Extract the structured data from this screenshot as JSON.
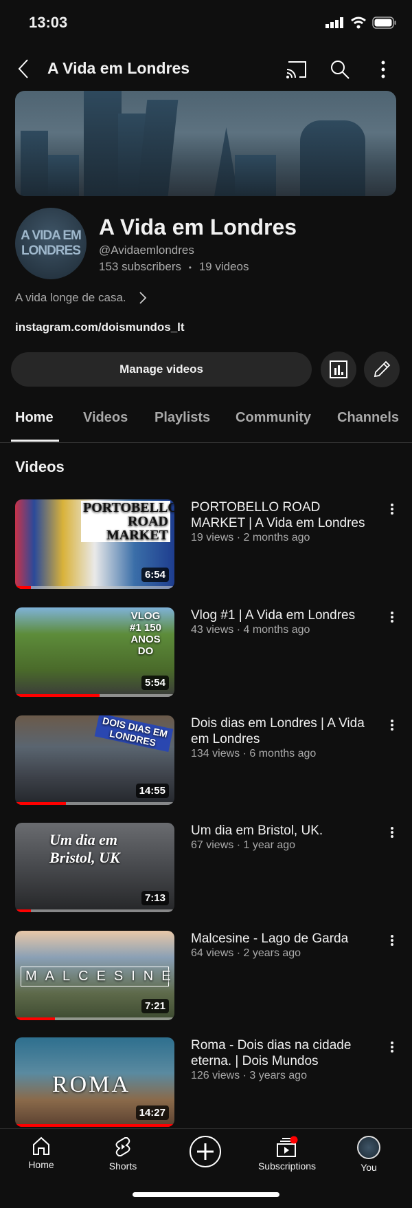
{
  "status_bar": {
    "time": "13:03"
  },
  "top_bar": {
    "title": "A Vida em Londres",
    "icons": [
      "back-icon",
      "cast-icon",
      "search-icon",
      "more-vertical-icon"
    ]
  },
  "channel": {
    "avatar_text": [
      "A VIDA EM",
      "LONDRES"
    ],
    "name": "A Vida em Londres",
    "handle": "@Avidaemlondres",
    "subscribers": "153 subscribers",
    "separator": "•",
    "videos_count": "19 videos",
    "description": "A vida longe de casa.",
    "link": "instagram.com/doismundos_lt"
  },
  "actions": {
    "manage_label": "Manage videos",
    "icons": [
      "analytics-icon",
      "edit-pencil-icon"
    ]
  },
  "tabs": [
    {
      "label": "Home",
      "active": true
    },
    {
      "label": "Videos"
    },
    {
      "label": "Playlists"
    },
    {
      "label": "Community"
    },
    {
      "label": "Channels"
    }
  ],
  "section_title": "Videos",
  "videos": [
    {
      "title": "PORTOBELLO ROAD MARKET | A Vida em Londres",
      "meta": "19 views · 2 months ago",
      "duration": "6:54",
      "progress": 0.1,
      "thumb_caption": "PORTOBELLO ROAD MARKET"
    },
    {
      "title": "Vlog #1 | A Vida em Londres",
      "meta": "43 views · 4 months ago",
      "duration": "5:54",
      "progress": 0.53,
      "thumb_caption": "VLOG #1 150 ANOS DO"
    },
    {
      "title": "Dois dias em Londres | A Vida em Londres",
      "meta": "134 views · 6 months ago",
      "duration": "14:55",
      "progress": 0.32,
      "thumb_caption": "DOIS DIAS EM LONDRES"
    },
    {
      "title": "Um dia em Bristol, UK.",
      "meta": "67 views · 1 year ago",
      "duration": "7:13",
      "progress": 0.1,
      "thumb_caption": "Um dia em Bristol, UK"
    },
    {
      "title": "Malcesine - Lago de Garda",
      "meta": "64 views · 2 years ago",
      "duration": "7:21",
      "progress": 0.25,
      "thumb_caption": "MALCESINE"
    },
    {
      "title": "Roma - Dois dias na cidade eterna. | Dois Mundos",
      "meta": "126 views · 3 years ago",
      "duration": "14:27",
      "progress": 1.0,
      "thumb_caption": "ROMA"
    }
  ],
  "bottom_nav": [
    {
      "label": "Home",
      "icon": "home-icon"
    },
    {
      "label": "Shorts",
      "icon": "shorts-icon"
    },
    {
      "label": "",
      "icon": "create-plus-icon"
    },
    {
      "label": "Subscriptions",
      "icon": "subscriptions-icon",
      "badge": true
    },
    {
      "label": "You",
      "icon": "avatar"
    }
  ],
  "colors": {
    "background": "#0f0f0f",
    "progress": "#ff0000",
    "chip": "#272727",
    "secondary_text": "#aaaaaa"
  }
}
